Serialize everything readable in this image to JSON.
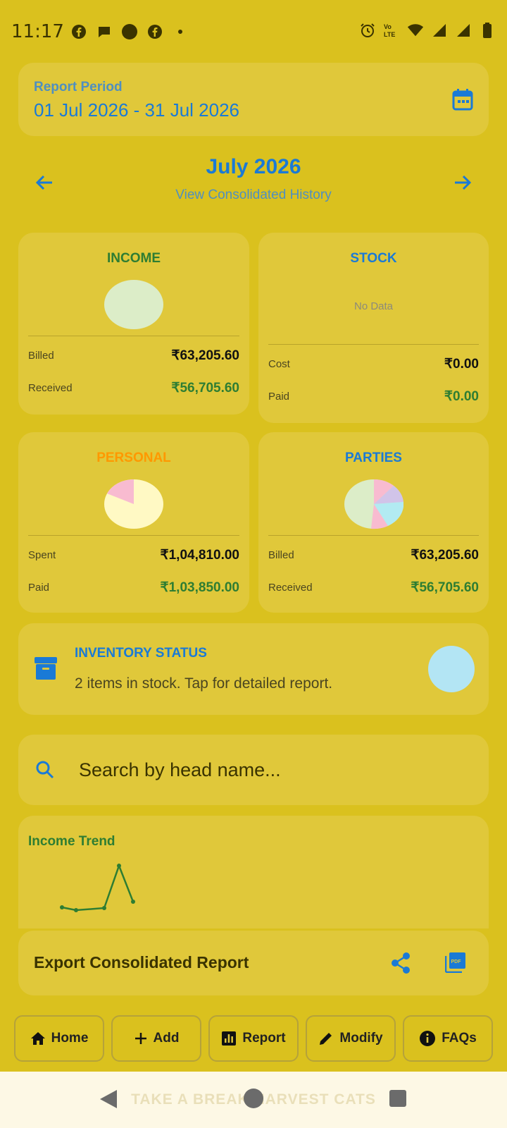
{
  "status_bar": {
    "time": "11:17"
  },
  "report_period": {
    "label": "Report Period",
    "value": "01 Jul 2026 - 31 Jul 2026"
  },
  "month_nav": {
    "title": "July 2026",
    "subtitle": "View Consolidated History"
  },
  "income": {
    "title": "INCOME",
    "rows": [
      {
        "label": "Billed",
        "value": "₹63,205.60"
      },
      {
        "label": "Received",
        "value": "₹56,705.60"
      }
    ]
  },
  "stock": {
    "title": "STOCK",
    "no_data": "No Data",
    "rows": [
      {
        "label": "Cost",
        "value": "₹0.00"
      },
      {
        "label": "Paid",
        "value": "₹0.00"
      }
    ]
  },
  "personal": {
    "title": "PERSONAL",
    "rows": [
      {
        "label": "Spent",
        "value": "₹1,04,810.00"
      },
      {
        "label": "Paid",
        "value": "₹1,03,850.00"
      }
    ]
  },
  "parties": {
    "title": "PARTIES",
    "rows": [
      {
        "label": "Billed",
        "value": "₹63,205.60"
      },
      {
        "label": "Received",
        "value": "₹56,705.60"
      }
    ]
  },
  "inventory": {
    "title": "INVENTORY STATUS",
    "description": "2 items in stock. Tap for detailed report."
  },
  "search": {
    "placeholder": "Search by head name..."
  },
  "trend": {
    "title": "Income Trend"
  },
  "export": {
    "title": "Export Consolidated Report"
  },
  "bottom_nav": {
    "home": "Home",
    "add": "Add",
    "report": "Report",
    "modify": "Modify",
    "faqs": "FAQs"
  },
  "system_nav": {
    "ad_text": "TAKE A BREAK HARVEST CATS"
  },
  "colors": {
    "background": "#DAC11E",
    "card": "#E0C83A",
    "accent_blue": "#1a7ad6",
    "positive_green": "#2e7d32",
    "personal_orange": "#FF9800"
  }
}
